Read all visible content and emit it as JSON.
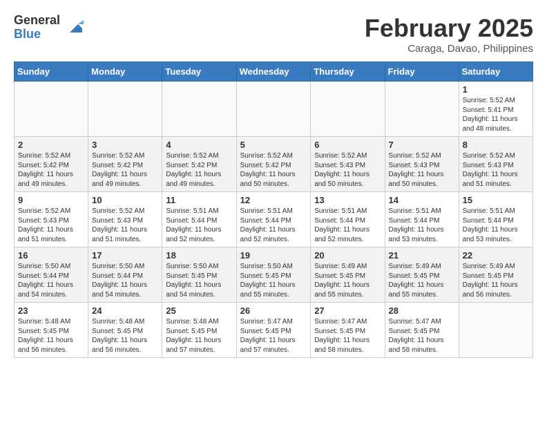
{
  "logo": {
    "general": "General",
    "blue": "Blue"
  },
  "header": {
    "month": "February 2025",
    "location": "Caraga, Davao, Philippines"
  },
  "weekdays": [
    "Sunday",
    "Monday",
    "Tuesday",
    "Wednesday",
    "Thursday",
    "Friday",
    "Saturday"
  ],
  "weeks": [
    [
      {
        "day": "",
        "info": ""
      },
      {
        "day": "",
        "info": ""
      },
      {
        "day": "",
        "info": ""
      },
      {
        "day": "",
        "info": ""
      },
      {
        "day": "",
        "info": ""
      },
      {
        "day": "",
        "info": ""
      },
      {
        "day": "1",
        "info": "Sunrise: 5:52 AM\nSunset: 5:41 PM\nDaylight: 11 hours\nand 48 minutes."
      }
    ],
    [
      {
        "day": "2",
        "info": "Sunrise: 5:52 AM\nSunset: 5:42 PM\nDaylight: 11 hours\nand 49 minutes."
      },
      {
        "day": "3",
        "info": "Sunrise: 5:52 AM\nSunset: 5:42 PM\nDaylight: 11 hours\nand 49 minutes."
      },
      {
        "day": "4",
        "info": "Sunrise: 5:52 AM\nSunset: 5:42 PM\nDaylight: 11 hours\nand 49 minutes."
      },
      {
        "day": "5",
        "info": "Sunrise: 5:52 AM\nSunset: 5:42 PM\nDaylight: 11 hours\nand 50 minutes."
      },
      {
        "day": "6",
        "info": "Sunrise: 5:52 AM\nSunset: 5:43 PM\nDaylight: 11 hours\nand 50 minutes."
      },
      {
        "day": "7",
        "info": "Sunrise: 5:52 AM\nSunset: 5:43 PM\nDaylight: 11 hours\nand 50 minutes."
      },
      {
        "day": "8",
        "info": "Sunrise: 5:52 AM\nSunset: 5:43 PM\nDaylight: 11 hours\nand 51 minutes."
      }
    ],
    [
      {
        "day": "9",
        "info": "Sunrise: 5:52 AM\nSunset: 5:43 PM\nDaylight: 11 hours\nand 51 minutes."
      },
      {
        "day": "10",
        "info": "Sunrise: 5:52 AM\nSunset: 5:43 PM\nDaylight: 11 hours\nand 51 minutes."
      },
      {
        "day": "11",
        "info": "Sunrise: 5:51 AM\nSunset: 5:44 PM\nDaylight: 11 hours\nand 52 minutes."
      },
      {
        "day": "12",
        "info": "Sunrise: 5:51 AM\nSunset: 5:44 PM\nDaylight: 11 hours\nand 52 minutes."
      },
      {
        "day": "13",
        "info": "Sunrise: 5:51 AM\nSunset: 5:44 PM\nDaylight: 11 hours\nand 52 minutes."
      },
      {
        "day": "14",
        "info": "Sunrise: 5:51 AM\nSunset: 5:44 PM\nDaylight: 11 hours\nand 53 minutes."
      },
      {
        "day": "15",
        "info": "Sunrise: 5:51 AM\nSunset: 5:44 PM\nDaylight: 11 hours\nand 53 minutes."
      }
    ],
    [
      {
        "day": "16",
        "info": "Sunrise: 5:50 AM\nSunset: 5:44 PM\nDaylight: 11 hours\nand 54 minutes."
      },
      {
        "day": "17",
        "info": "Sunrise: 5:50 AM\nSunset: 5:44 PM\nDaylight: 11 hours\nand 54 minutes."
      },
      {
        "day": "18",
        "info": "Sunrise: 5:50 AM\nSunset: 5:45 PM\nDaylight: 11 hours\nand 54 minutes."
      },
      {
        "day": "19",
        "info": "Sunrise: 5:50 AM\nSunset: 5:45 PM\nDaylight: 11 hours\nand 55 minutes."
      },
      {
        "day": "20",
        "info": "Sunrise: 5:49 AM\nSunset: 5:45 PM\nDaylight: 11 hours\nand 55 minutes."
      },
      {
        "day": "21",
        "info": "Sunrise: 5:49 AM\nSunset: 5:45 PM\nDaylight: 11 hours\nand 55 minutes."
      },
      {
        "day": "22",
        "info": "Sunrise: 5:49 AM\nSunset: 5:45 PM\nDaylight: 11 hours\nand 56 minutes."
      }
    ],
    [
      {
        "day": "23",
        "info": "Sunrise: 5:48 AM\nSunset: 5:45 PM\nDaylight: 11 hours\nand 56 minutes."
      },
      {
        "day": "24",
        "info": "Sunrise: 5:48 AM\nSunset: 5:45 PM\nDaylight: 11 hours\nand 56 minutes."
      },
      {
        "day": "25",
        "info": "Sunrise: 5:48 AM\nSunset: 5:45 PM\nDaylight: 11 hours\nand 57 minutes."
      },
      {
        "day": "26",
        "info": "Sunrise: 5:47 AM\nSunset: 5:45 PM\nDaylight: 11 hours\nand 57 minutes."
      },
      {
        "day": "27",
        "info": "Sunrise: 5:47 AM\nSunset: 5:45 PM\nDaylight: 11 hours\nand 58 minutes."
      },
      {
        "day": "28",
        "info": "Sunrise: 5:47 AM\nSunset: 5:45 PM\nDaylight: 11 hours\nand 58 minutes."
      },
      {
        "day": "",
        "info": ""
      }
    ]
  ]
}
